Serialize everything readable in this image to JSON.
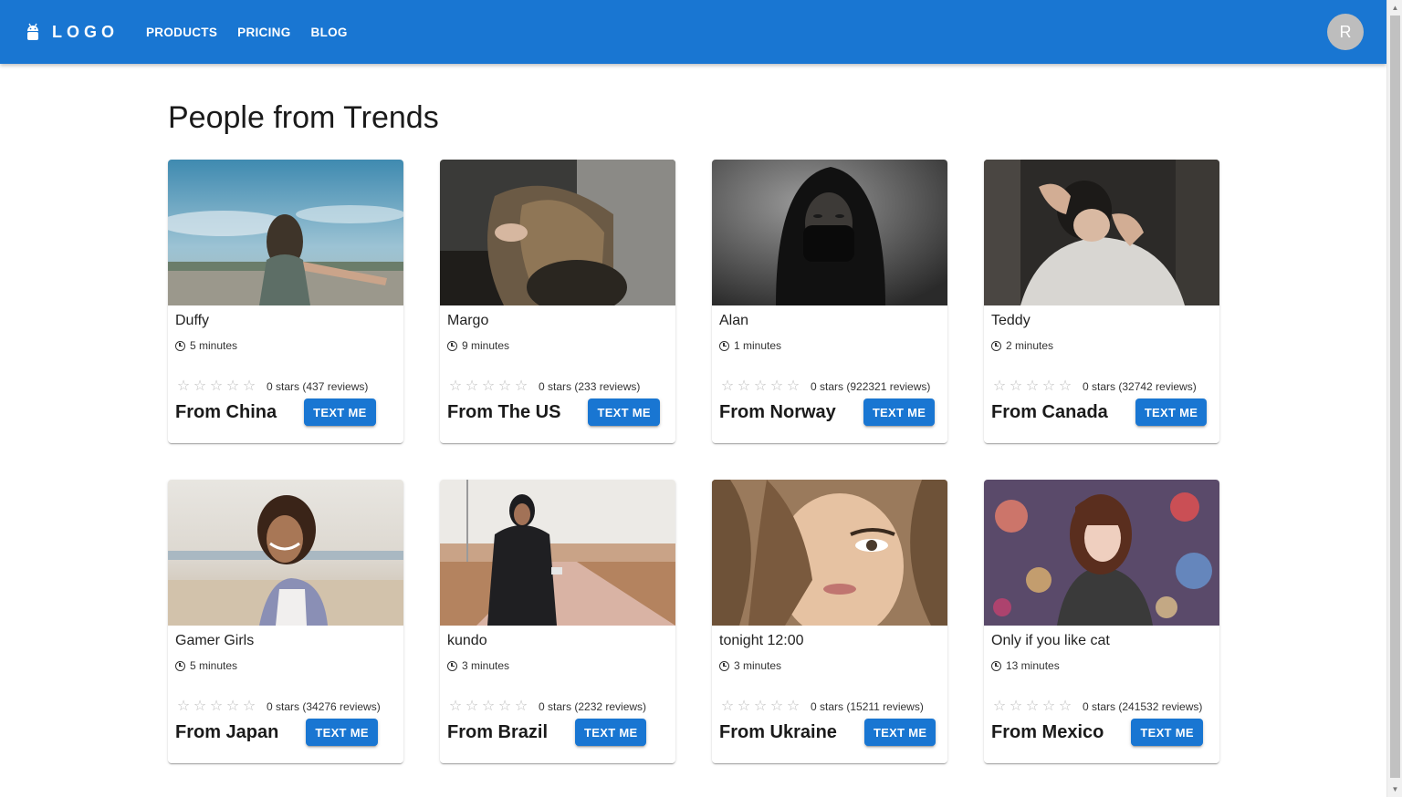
{
  "header": {
    "logo_text": "LOGO",
    "nav": [
      "PRODUCTS",
      "PRICING",
      "BLOG"
    ],
    "avatar_initial": "R",
    "accent_color": "#1976d2"
  },
  "main": {
    "title": "People from Trends",
    "button_label": "TEXT ME",
    "cards": [
      {
        "name": "Duffy",
        "time": "5 minutes",
        "rating": "0 stars (437 reviews)",
        "location": "From China"
      },
      {
        "name": "Margo",
        "time": "9 minutes",
        "rating": "0 stars (233 reviews)",
        "location": "From The US"
      },
      {
        "name": "Alan",
        "time": "1 minutes",
        "rating": "0 stars (922321 reviews)",
        "location": "From Norway"
      },
      {
        "name": "Teddy",
        "time": "2 minutes",
        "rating": "0 stars (32742 reviews)",
        "location": "From Canada"
      },
      {
        "name": "Gamer Girls",
        "time": "5 minutes",
        "rating": "0 stars (34276 reviews)",
        "location": "From Japan"
      },
      {
        "name": "kundo",
        "time": "3 minutes",
        "rating": "0 stars (2232 reviews)",
        "location": "From Brazil"
      },
      {
        "name": "tonight 12:00",
        "time": "3 minutes",
        "rating": "0 stars (15211 reviews)",
        "location": "From Ukraine"
      },
      {
        "name": "Only if you like cat",
        "time": "13 minutes",
        "rating": "0 stars (241532 reviews)",
        "location": "From Mexico"
      }
    ]
  }
}
